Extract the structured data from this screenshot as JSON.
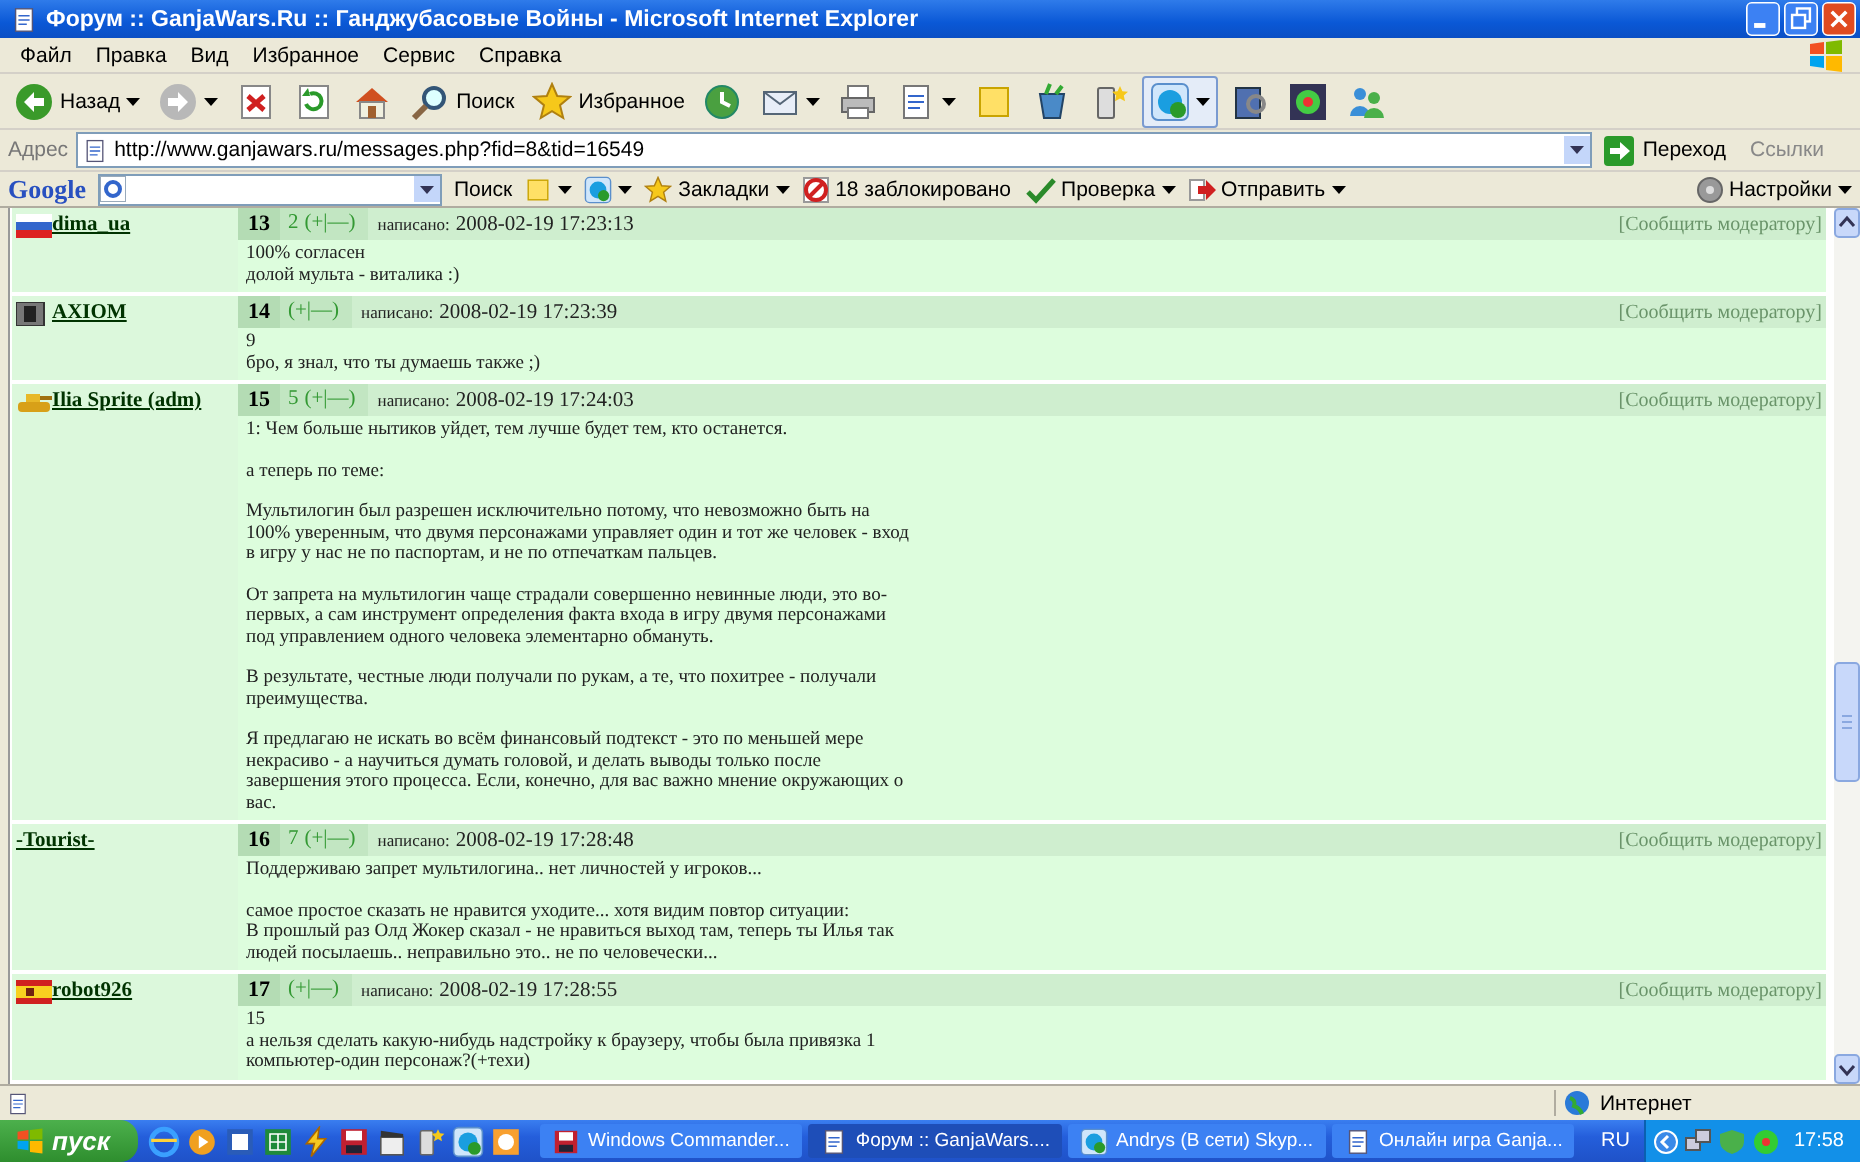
{
  "window": {
    "title": "Форум :: GanjaWars.Ru :: Ганджубасовые Войны - Microsoft Internet Explorer"
  },
  "menu": [
    "Файл",
    "Правка",
    "Вид",
    "Избранное",
    "Сервис",
    "Справка"
  ],
  "toolbar": [
    {
      "label": "Назад",
      "dropdown": true
    },
    {
      "dropdown": true
    },
    {
      "dropdown": false
    },
    {
      "dropdown": false
    },
    {
      "dropdown": false
    },
    {
      "label": "Поиск",
      "dropdown": false
    },
    {
      "label": "Избранное",
      "dropdown": false
    },
    {
      "dropdown": false
    },
    {
      "dropdown": true
    },
    {
      "dropdown": false
    },
    {
      "dropdown": true
    },
    {
      "dropdown": false
    },
    {
      "dropdown": false
    },
    {
      "dropdown": false
    },
    {
      "dropdown": true
    },
    {
      "dropdown": false
    },
    {
      "dropdown": false
    },
    {
      "dropdown": false
    }
  ],
  "address": {
    "label": "Адрес",
    "url": "http://www.ganjawars.ru/messages.php?fid=8&tid=16549",
    "go": "Переход",
    "links": "Ссылки"
  },
  "google_bar": {
    "logo": "Google",
    "search": "Поиск",
    "bookmarks": "Закладки",
    "blocked": "18 заблокировано",
    "check": "Проверка",
    "send": "Отправить",
    "settings": "Настройки"
  },
  "posts": [
    {
      "user": "dima_ua",
      "number": "13",
      "rating": "2",
      "vote": "(+|—)",
      "date_label": "написано:",
      "date": "2008-02-19 17:23:13",
      "report": "[Сообщить модератору]",
      "paragraphs": [
        "100% согласен\nдолой мульта - виталика :)"
      ]
    },
    {
      "user": "AXIOM",
      "number": "14",
      "vote": "(+|—)",
      "date_label": "написано:",
      "date": "2008-02-19 17:23:39",
      "report": "[Сообщить модератору]",
      "paragraphs": [
        "9\nбро, я знал, что ты думаешь также ;)"
      ]
    },
    {
      "user": "Ilia Sprite (adm)",
      "number": "15",
      "rating": "5",
      "vote": "(+|—)",
      "date_label": "написано:",
      "date": "2008-02-19 17:24:03",
      "report": "[Сообщить модератору]",
      "paragraphs": [
        "1: Чем больше нытиков уйдет, тем лучше будет тем, кто останется.",
        "а теперь по теме:",
        "Мультилогин был разрешен исключительно потому, что невозможно быть на 100% уверенным, что двумя персонажами управляет один и тот же человек - вход в игру у нас не по паспортам, и не по отпечаткам пальцев.",
        "От запрета на мультилогин чаще страдали совершенно невинные люди, это во-первых, а сам инструмент определения факта входа в игру двумя персонажами под управлением одного человека элементарно обмануть.",
        "В результате, честные люди получали по рукам, а те, что похитрее - получали преимущества.",
        "Я предлагаю не искать во всём финансовый подтекст - это по меньшей мере некрасиво - а научиться думать головой, и делать выводы только после завершения этого процесса. Если, конечно, для вас важно мнение окружающих о вас."
      ]
    },
    {
      "user": "-Tourist-",
      "number": "16",
      "rating": "7",
      "vote": "(+|—)",
      "date_label": "написано:",
      "date": "2008-02-19 17:28:48",
      "report": "[Сообщить модератору]",
      "paragraphs": [
        "Поддерживаю запрет мультилогина.. нет личностей у игроков...",
        "самое простое сказать не нравится уходите... хотя видим повтор ситуации:\nВ прошлый раз Олд Жокер сказал - не нравиться выход там, теперь ты Илья так людей посылаешь.. неправильно это.. не по человечески..."
      ]
    },
    {
      "user": "robot926",
      "number": "17",
      "vote": "(+|—)",
      "date_label": "написано:",
      "date": "2008-02-19 17:28:55",
      "report": "[Сообщить модератору]",
      "paragraphs": [
        "15\nа нельзя сделать какую-нибудь надстройку к браузеру, чтобы была привязка 1 компьютер-один персонаж?(+техи)"
      ]
    }
  ],
  "status_bar": {
    "zone": "Интернет"
  },
  "taskbar": {
    "start": "пуск",
    "tasks": [
      {
        "label": "Windows Commander...",
        "selected": false
      },
      {
        "label": "Форум :: GanjaWars....",
        "selected": true
      },
      {
        "label": "Andrys (В сети) Skyp...",
        "selected": false
      },
      {
        "label": "Онлайн игра Ganja...",
        "selected": false
      }
    ],
    "lang": "RU",
    "clock": "17:58"
  }
}
